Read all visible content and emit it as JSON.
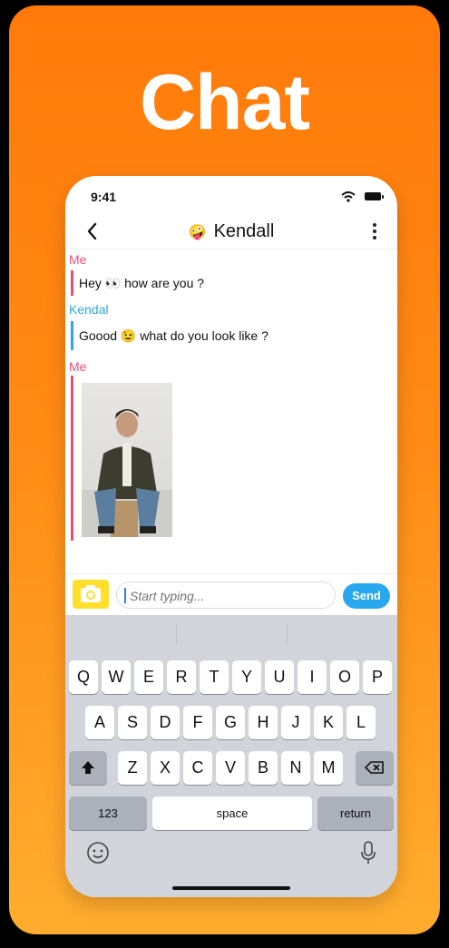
{
  "promo": {
    "headline": "Chat"
  },
  "status_bar": {
    "time": "9:41"
  },
  "header": {
    "contact_name": "Kendall",
    "avatar_emoji": "🤪"
  },
  "messages": [
    {
      "sender": "Me",
      "text": "Hey 👀 how are you ?"
    },
    {
      "sender": "Kendal",
      "text": "Goood 😉 what do you look like ?"
    },
    {
      "sender": "Me",
      "text": ""
    }
  ],
  "composer": {
    "placeholder": "Start typing...",
    "send_label": "Send"
  },
  "keyboard": {
    "row1": [
      "Q",
      "W",
      "E",
      "R",
      "T",
      "Y",
      "U",
      "I",
      "O",
      "P"
    ],
    "row2": [
      "A",
      "S",
      "D",
      "F",
      "G",
      "H",
      "J",
      "K",
      "L"
    ],
    "row3": [
      "Z",
      "X",
      "C",
      "V",
      "B",
      "N",
      "M"
    ],
    "numbers_label": "123",
    "space_label": "space",
    "return_label": "return"
  },
  "colors": {
    "me": "#e64d7a",
    "them": "#29a9e0",
    "accent": "#2aa8ef",
    "camera": "#ffdf2b",
    "background": "#ff8a14"
  }
}
